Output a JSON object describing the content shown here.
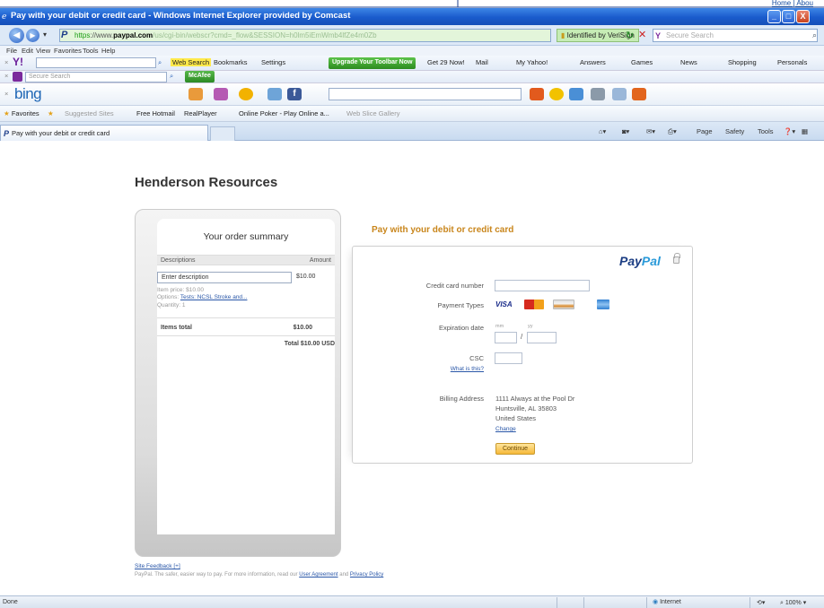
{
  "top_links": {
    "text": "Home | Abou"
  },
  "window": {
    "title": "Pay with your debit or credit card - Windows Internet Explorer provided by Comcast",
    "minimize": "_",
    "maximize": "□",
    "close": "X"
  },
  "address_bar": {
    "scheme": "https",
    "domain": "paypal.com",
    "rest": "/us/cgi-bin/webscr?cmd=_flow&SESSION=h0lm5iEmWmb4lfZe4m0Zb",
    "identity": "Identified by VeriSign",
    "search_placeholder": "Secure Search"
  },
  "menu": {
    "items": [
      "File",
      "Edit",
      "View",
      "Favorites",
      "Tools",
      "Help"
    ]
  },
  "yahoo_toolbar": {
    "web_search": "Web Search",
    "bookmarks": "Bookmarks",
    "settings": "Settings",
    "upgrade": "Upgrade Your Toolbar Now",
    "get_now": "Get 29 Now!",
    "mail": "Mail",
    "my_yahoo": "My Yahoo!",
    "answers": "Answers",
    "games": "Games",
    "news": "News",
    "shopping": "Shopping",
    "personals": "Personals",
    "secure_search_placeholder": "Secure Search",
    "mcafee": "McAfee"
  },
  "bing": {
    "logo": "bing"
  },
  "favorites_bar": {
    "favorites": "Favorites",
    "suggested": "Suggested Sites",
    "hotmail": "Free Hotmail",
    "realplayer": "RealPlayer",
    "poker": "Online Poker - Play Online a...",
    "slice_gallery": "Web Slice Gallery"
  },
  "tab": {
    "title": "Pay with your debit or credit card"
  },
  "command_bar": {
    "page": "Page",
    "safety": "Safety",
    "tools": "Tools"
  },
  "page": {
    "merchant": "Henderson Resources",
    "summary": {
      "title": "Your order summary",
      "col_description": "Descriptions",
      "col_amount": "Amount",
      "description_input": "Enter description",
      "item_amount": "$10.00",
      "item_price": "Item price: $10.00",
      "options_label": "Options:",
      "options_link": "Tests: NCSL Stroke and...",
      "quantity": "Quantity: 1",
      "items_total_label": "Items total",
      "items_total_value": "$10.00",
      "grand_total": "Total $10.00 USD"
    },
    "pay": {
      "heading": "Pay with your debit or credit card",
      "paypal_pay": "Pay",
      "paypal_pal": "Pal",
      "cc_number_label": "Credit card number",
      "payment_types_label": "Payment Types",
      "visa": "VISA",
      "expiration_label": "Expiration date",
      "exp_mm_hint": "mm",
      "exp_yy_hint": "yy",
      "exp_separator": "/",
      "csc_label": "CSC",
      "csc_help": "What is this?",
      "billing_label": "Billing Address",
      "billing_lines": [
        "1111 Always at the Pool Dr",
        "Huntsville, AL 35803",
        "United States"
      ],
      "change": "Change",
      "continue": "Continue"
    },
    "footer": {
      "site_feedback": "Site Feedback [+]",
      "text": "PayPal. The safer, easier way to pay. For more information, read our",
      "user_agreement": "User Agreement",
      "and": "and",
      "privacy": "Privacy Policy"
    }
  },
  "status_bar": {
    "status": "Done",
    "zone": "Internet",
    "zoom": "100%"
  }
}
